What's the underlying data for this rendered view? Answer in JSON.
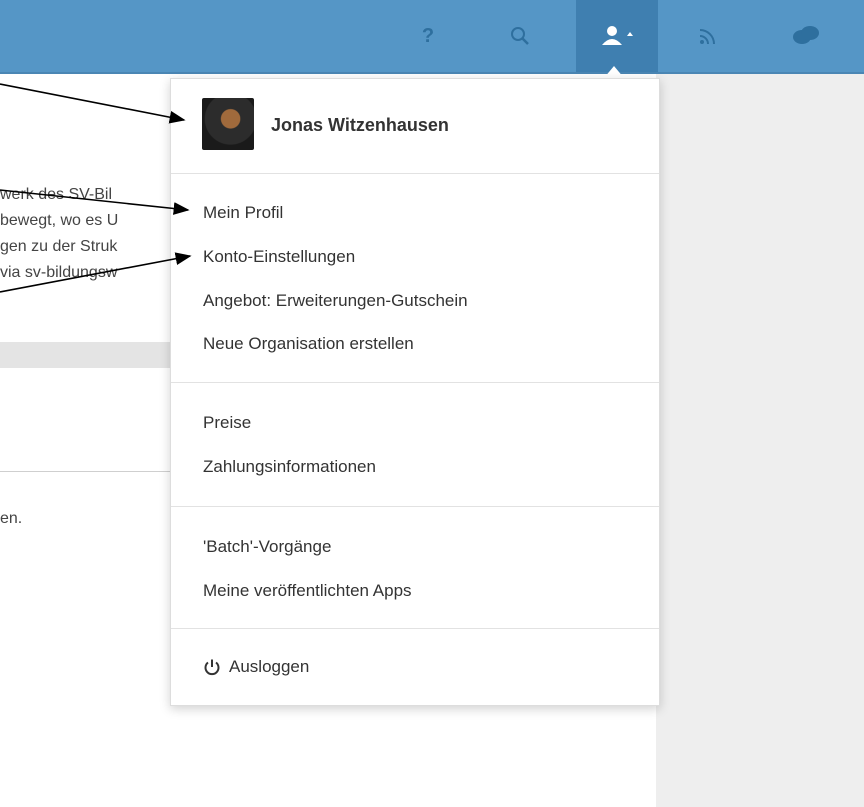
{
  "topbar": {
    "icons": [
      "help-icon",
      "search-icon",
      "user-icon",
      "rss-icon",
      "chat-icon"
    ],
    "help_glyph": "?"
  },
  "background": {
    "lines": [
      "werk des SV-Bil",
      "bewegt, wo es U",
      "gen zu der Struk",
      "via sv-bildungsw"
    ],
    "footer_fragment": "en."
  },
  "user": {
    "name": "Jonas Witzenhausen"
  },
  "menu": {
    "group1": [
      "Mein Profil",
      "Konto-Einstellungen",
      "Angebot: Erweiterungen-Gutschein",
      "Neue Organisation erstellen"
    ],
    "group2": [
      "Preise",
      "Zahlungsinformationen"
    ],
    "group3": [
      "'Batch'-Vorgänge",
      "Meine veröffentlichten Apps"
    ],
    "logout_label": "Ausloggen"
  },
  "colors": {
    "topbar": "#5596c6",
    "topbar_active": "#3f7fb0"
  }
}
